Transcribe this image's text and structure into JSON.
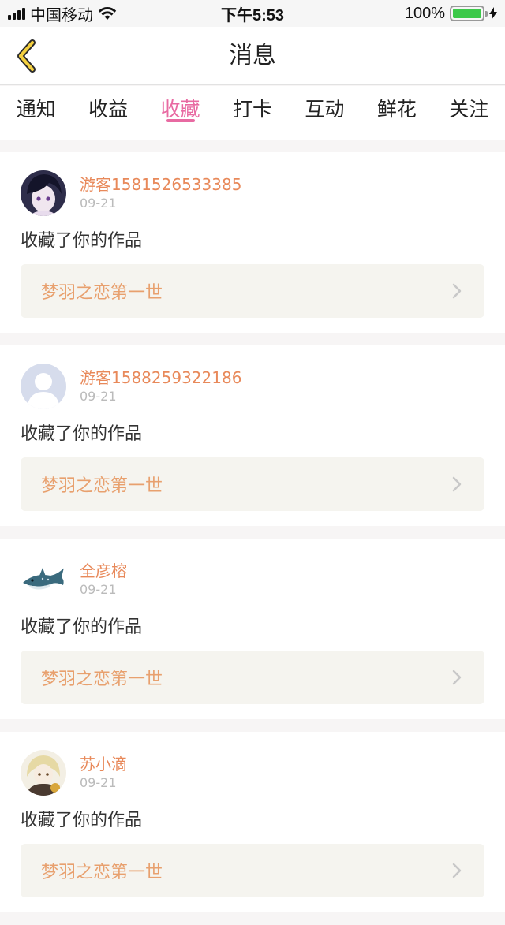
{
  "status": {
    "carrier": "中国移动",
    "time": "下午5:53",
    "battery": "100%",
    "battery_level": 1.0
  },
  "nav": {
    "title": "消息"
  },
  "tabs": [
    {
      "label": "通知",
      "active": false
    },
    {
      "label": "收益",
      "active": false
    },
    {
      "label": "收藏",
      "active": true
    },
    {
      "label": "打卡",
      "active": false
    },
    {
      "label": "互动",
      "active": false
    },
    {
      "label": "鲜花",
      "active": false
    },
    {
      "label": "关注",
      "active": false
    }
  ],
  "messages": [
    {
      "username": "游客1581526533385",
      "date": "09-21",
      "action": "收藏了你的作品",
      "work": "梦羽之恋第一世",
      "avatar": "anime-avatar-dark"
    },
    {
      "username": "游客1588259322186",
      "date": "09-21",
      "action": "收藏了你的作品",
      "work": "梦羽之恋第一世",
      "avatar": "default-avatar"
    },
    {
      "username": "全彦榕",
      "date": "09-21",
      "action": "收藏了你的作品",
      "work": "梦羽之恋第一世",
      "avatar": "shark-avatar"
    },
    {
      "username": "苏小滴",
      "date": "09-21",
      "action": "收藏了你的作品",
      "work": "梦羽之恋第一世",
      "avatar": "anime-avatar-blonde"
    }
  ],
  "colors": {
    "accent": "#e86aa2",
    "username": "#e8895a",
    "work": "#e8a06e",
    "battery": "#3cc94a"
  }
}
